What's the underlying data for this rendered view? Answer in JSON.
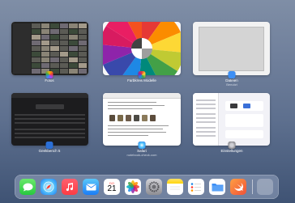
{
  "app_switcher": {
    "cards": [
      {
        "name": "Fotos",
        "subtitle": ""
      },
      {
        "name": "Farbkreis Modelle",
        "subtitle": ""
      },
      {
        "name": "Dateien",
        "subtitle": "Benutzt"
      },
      {
        "name": "Geekbench 5",
        "subtitle": ""
      },
      {
        "name": "Safari",
        "subtitle": "notebook-check.com"
      },
      {
        "name": "Einstellungen",
        "subtitle": ""
      }
    ]
  },
  "dock": {
    "items": [
      {
        "label": "Nachrichten",
        "icon": "messages-icon"
      },
      {
        "label": "Safari",
        "icon": "safari-icon"
      },
      {
        "label": "Musik",
        "icon": "music-icon"
      },
      {
        "label": "Mail",
        "icon": "mail-icon"
      },
      {
        "label": "Kalender",
        "icon": "calendar-icon",
        "weekday": "DO",
        "day": "21"
      },
      {
        "label": "Fotos",
        "icon": "photos-icon"
      },
      {
        "label": "Einstellungen",
        "icon": "settings-icon"
      },
      {
        "label": "Notizen",
        "icon": "notes-icon"
      },
      {
        "label": "Erinnerungen",
        "icon": "reminders-icon"
      },
      {
        "label": "Dateien",
        "icon": "files-icon"
      },
      {
        "label": "Swift Playgrounds",
        "icon": "swift-icon"
      },
      {
        "label": "App-Mediathek",
        "icon": "app-library-icon"
      }
    ]
  },
  "colors": {
    "wallpaper_top": "#7f8ea6",
    "wallpaper_bottom": "#3f5374",
    "files_blue": "#3d8ff5",
    "geekbench_blue": "#2b6fd6"
  }
}
